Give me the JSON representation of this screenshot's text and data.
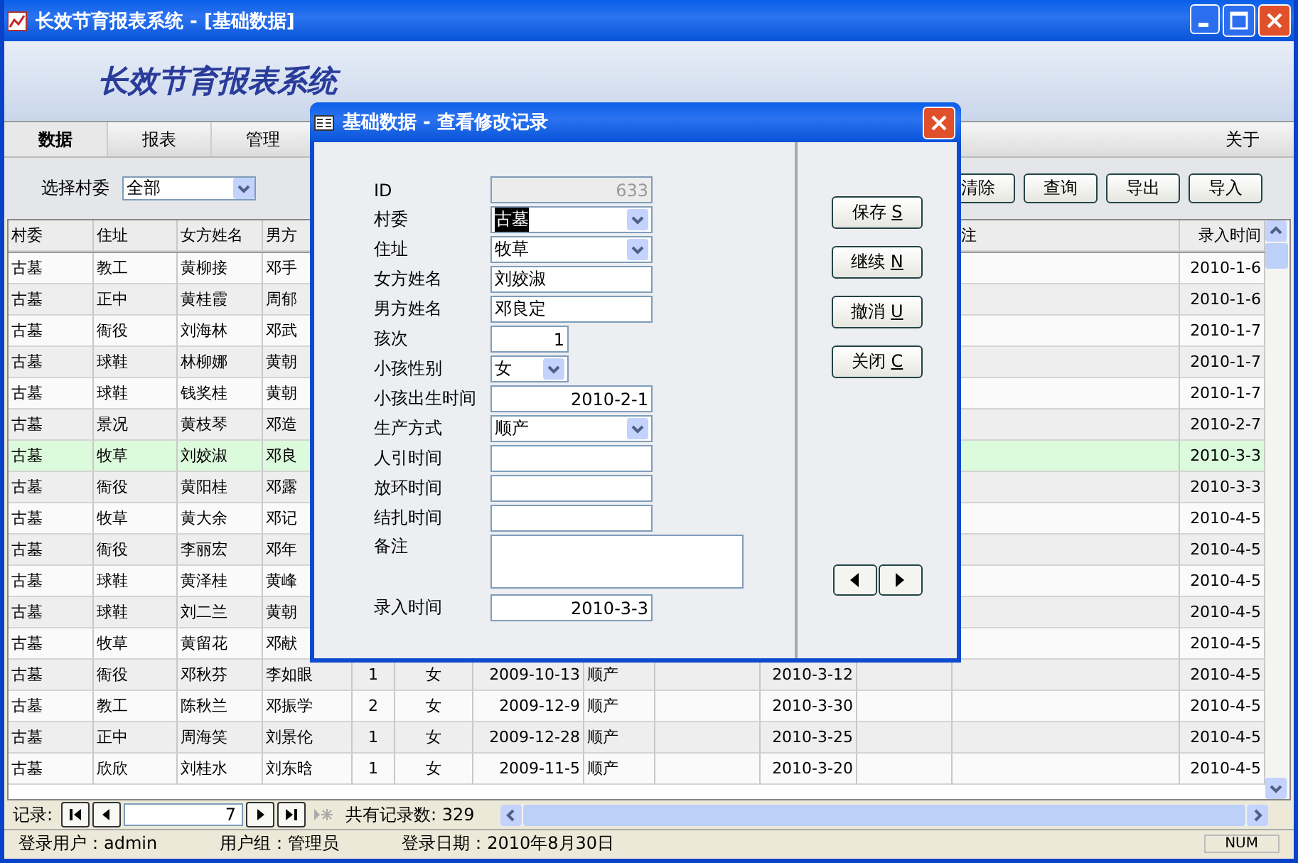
{
  "window": {
    "title": "长效节育报表系统 - [基础数据]"
  },
  "banner": {
    "title": "长效节育报表系统"
  },
  "menu": {
    "items": [
      {
        "label": "数据",
        "selected": true
      },
      {
        "label": "报表",
        "selected": false
      },
      {
        "label": "管理",
        "selected": false
      }
    ],
    "right_items": [
      {
        "label": "关于",
        "selected": false
      }
    ]
  },
  "filter": {
    "label": "选择村委",
    "value": "全部"
  },
  "toolbar": {
    "buttons": [
      "清除",
      "查询",
      "导出",
      "导入"
    ]
  },
  "table": {
    "columns": [
      "村委",
      "住址",
      "女方姓名",
      "男方",
      null,
      null,
      null,
      null,
      null,
      null,
      null,
      "注",
      "录入时间"
    ],
    "rows": [
      {
        "selected": false,
        "cells": [
          "古墓",
          "教工",
          "黄柳接",
          "邓手",
          null,
          null,
          null,
          null,
          null,
          null,
          null,
          null,
          "2010-1-6"
        ]
      },
      {
        "selected": false,
        "cells": [
          "古墓",
          "正中",
          "黄桂霞",
          "周郁",
          null,
          null,
          null,
          null,
          null,
          null,
          null,
          null,
          "2010-1-6"
        ]
      },
      {
        "selected": false,
        "cells": [
          "古墓",
          "衙役",
          "刘海林",
          "邓武",
          null,
          null,
          null,
          null,
          null,
          null,
          null,
          null,
          "2010-1-7"
        ]
      },
      {
        "selected": false,
        "cells": [
          "古墓",
          "球鞋",
          "林柳娜",
          "黄朝",
          null,
          null,
          null,
          null,
          null,
          null,
          null,
          null,
          "2010-1-7"
        ]
      },
      {
        "selected": false,
        "cells": [
          "古墓",
          "球鞋",
          "钱奖桂",
          "黄朝",
          null,
          null,
          null,
          null,
          null,
          null,
          null,
          null,
          "2010-1-7"
        ]
      },
      {
        "selected": false,
        "cells": [
          "古墓",
          "景况",
          "黄枝琴",
          "邓造",
          null,
          null,
          null,
          null,
          null,
          null,
          null,
          null,
          "2010-2-7"
        ]
      },
      {
        "selected": true,
        "cells": [
          "古墓",
          "牧草",
          "刘姣淑",
          "邓良",
          null,
          null,
          null,
          null,
          null,
          null,
          null,
          null,
          "2010-3-3"
        ]
      },
      {
        "selected": false,
        "cells": [
          "古墓",
          "衙役",
          "黄阳桂",
          "邓露",
          null,
          null,
          null,
          null,
          null,
          null,
          null,
          null,
          "2010-3-3"
        ]
      },
      {
        "selected": false,
        "cells": [
          "古墓",
          "牧草",
          "黄大余",
          "邓记",
          null,
          null,
          null,
          null,
          null,
          null,
          null,
          null,
          "2010-4-5"
        ]
      },
      {
        "selected": false,
        "cells": [
          "古墓",
          "衙役",
          "李丽宏",
          "邓年",
          null,
          null,
          null,
          null,
          null,
          null,
          null,
          null,
          "2010-4-5"
        ]
      },
      {
        "selected": false,
        "cells": [
          "古墓",
          "球鞋",
          "黄泽桂",
          "黄峰",
          null,
          null,
          null,
          null,
          null,
          null,
          null,
          null,
          "2010-4-5"
        ]
      },
      {
        "selected": false,
        "cells": [
          "古墓",
          "球鞋",
          "刘二兰",
          "黄朝",
          null,
          null,
          null,
          null,
          null,
          null,
          null,
          null,
          "2010-4-5"
        ]
      },
      {
        "selected": false,
        "cells": [
          "古墓",
          "牧草",
          "黄留花",
          "邓献",
          null,
          null,
          null,
          null,
          null,
          null,
          null,
          null,
          "2010-4-5"
        ]
      },
      {
        "selected": false,
        "cells": [
          "古墓",
          "衙役",
          "邓秋芬",
          "李如眼",
          "1",
          "女",
          "2009-10-13",
          "顺产",
          null,
          "2010-3-12",
          null,
          null,
          "2010-4-5"
        ]
      },
      {
        "selected": false,
        "cells": [
          "古墓",
          "教工",
          "陈秋兰",
          "邓振学",
          "2",
          "女",
          "2009-12-9",
          "顺产",
          null,
          "2010-3-30",
          null,
          null,
          "2010-4-5"
        ]
      },
      {
        "selected": false,
        "cells": [
          "古墓",
          "正中",
          "周海笑",
          "刘景伦",
          "1",
          "女",
          "2009-12-28",
          "顺产",
          null,
          "2010-3-25",
          null,
          null,
          "2010-4-5"
        ]
      },
      {
        "selected": false,
        "cells": [
          "古墓",
          "欣欣",
          "刘桂水",
          "刘东晗",
          "1",
          "女",
          "2009-11-5",
          "顺产",
          null,
          "2010-3-20",
          null,
          null,
          "2010-4-5"
        ]
      }
    ]
  },
  "navigator": {
    "label": "记录:",
    "current": "7",
    "total": "共有记录数: 329"
  },
  "status_bar": {
    "items": [
      "登录用户：admin",
      "用户组：管理员",
      "登录日期：2010年8月30日"
    ],
    "indicator": "NUM"
  },
  "dialog": {
    "title": "基础数据 - 查看修改记录",
    "fields": [
      {
        "kind": "id",
        "label": "ID",
        "value": "633",
        "disabled": true
      },
      {
        "kind": "combo",
        "label": "村委",
        "value": "古墓",
        "highlighted": true
      },
      {
        "kind": "combo",
        "label": "住址",
        "value": "牧草",
        "highlighted": false
      },
      {
        "kind": "text",
        "label": "女方姓名",
        "value": "刘姣淑"
      },
      {
        "kind": "text",
        "label": "男方姓名",
        "value": "邓良定"
      },
      {
        "kind": "count",
        "label": "孩次",
        "value": "1"
      },
      {
        "kind": "choice",
        "label": "小孩性别",
        "value": "女"
      },
      {
        "kind": "date",
        "label": "小孩出生时间",
        "value": "2010-2-1"
      },
      {
        "kind": "combo",
        "label": "生产方式",
        "value": "顺产",
        "highlighted": false
      },
      {
        "kind": "date",
        "label": "人引时间"
      },
      {
        "kind": "date",
        "label": "放环时间"
      },
      {
        "kind": "date",
        "label": "结扎时间"
      },
      {
        "kind": "memo",
        "label": "备注"
      },
      {
        "kind": "date",
        "label": "录入时间",
        "value": "2010-3-3"
      }
    ],
    "buttons": [
      {
        "label": "保存",
        "hotkey": "S"
      },
      {
        "label": "继续",
        "hotkey": "N"
      },
      {
        "label": "撤消",
        "hotkey": "U"
      },
      {
        "label": "关闭",
        "hotkey": "C"
      }
    ]
  }
}
